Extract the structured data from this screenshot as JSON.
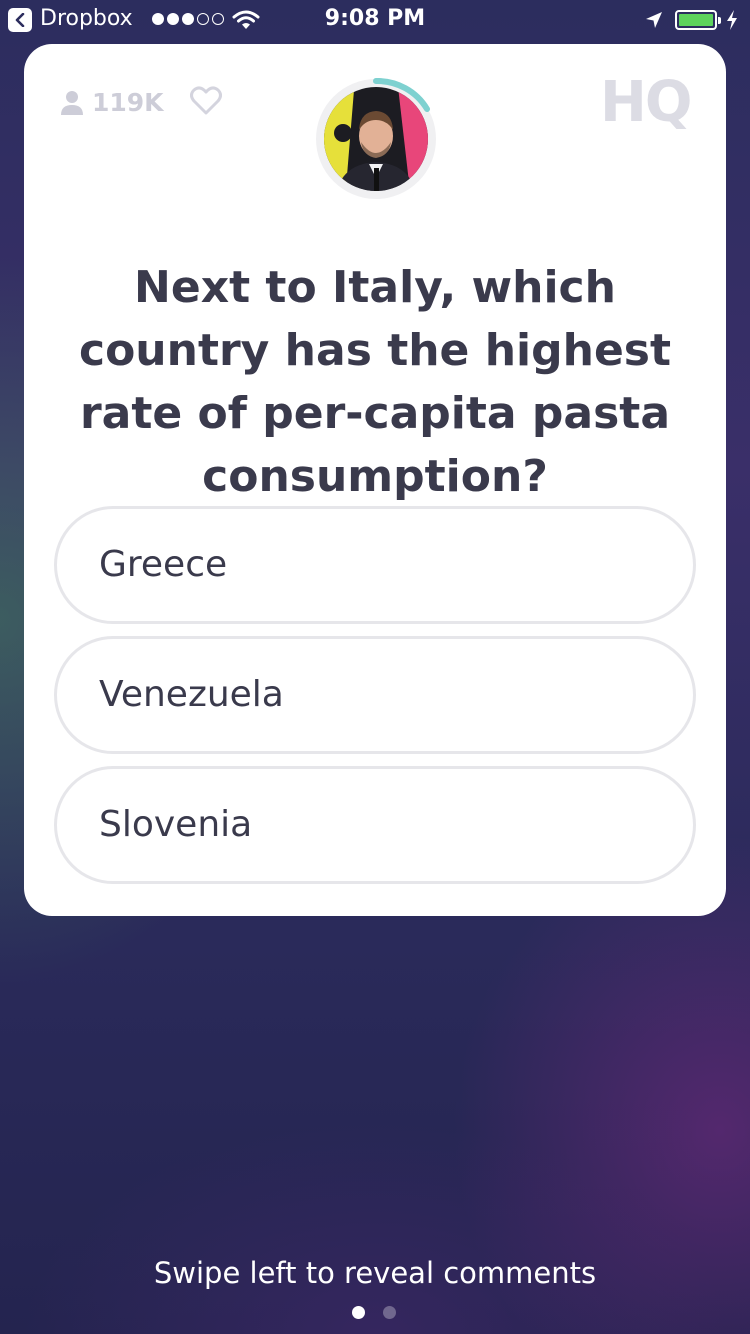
{
  "status_bar": {
    "back_app": "Dropbox",
    "time": "9:08 PM",
    "signal_filled": 3,
    "signal_total": 5,
    "battery_color": "#5ed35c"
  },
  "card": {
    "viewer_count": "119K",
    "logo_text": "HQ",
    "timer_color": "#7ed1d0",
    "question": "Next to Italy, which country has the highest rate of per-capita pasta consumption?",
    "answers": [
      {
        "label": "Greece"
      },
      {
        "label": "Venezuela"
      },
      {
        "label": "Slovenia"
      }
    ]
  },
  "footer": {
    "hint": "Swipe left to reveal comments",
    "pages": 2,
    "active_page": 1
  }
}
